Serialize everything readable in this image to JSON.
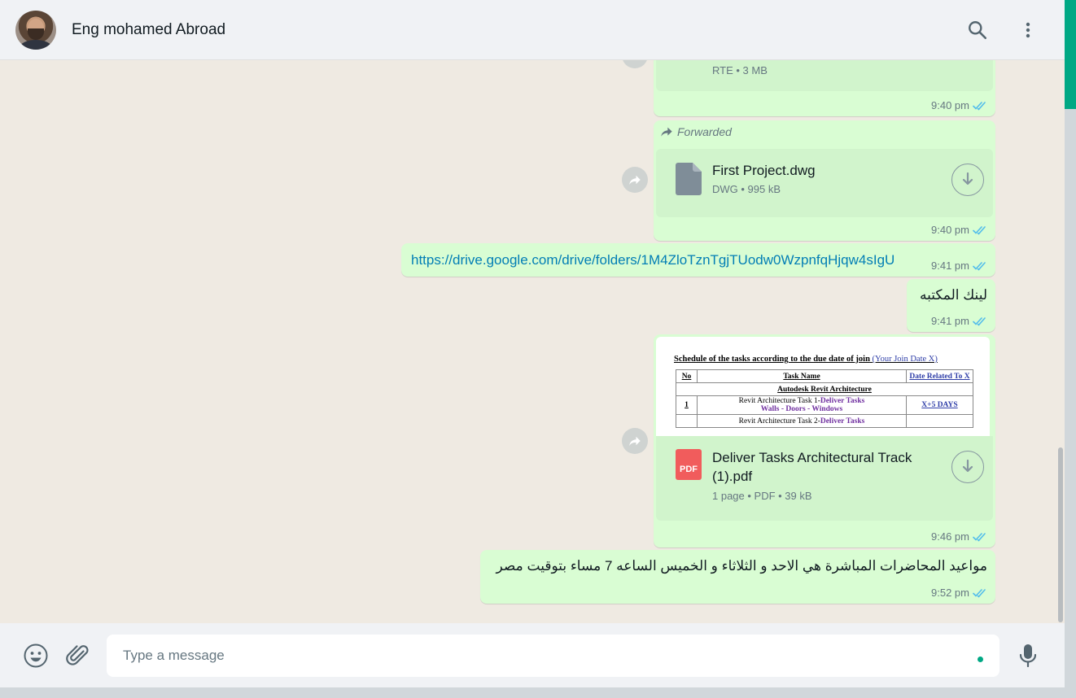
{
  "header": {
    "contact_name": "Eng mohamed Abroad",
    "icons": [
      "search-icon",
      "menu-dots-icon"
    ]
  },
  "messages": {
    "doc_top": {
      "sub": "RTE • 3 MB",
      "time": "9:40 pm"
    },
    "doc_dwg": {
      "forwarded_label": "Forwarded",
      "name": "First Project.dwg",
      "sub": "DWG • 995 kB",
      "time": "9:40 pm"
    },
    "link_msg": {
      "text": "https://drive.google.com/drive/folders/1M4ZloTznTgjTUodw0WzpnfqHjqw4sIgU",
      "time": "9:41 pm"
    },
    "text_library": {
      "text": "لينك المكتبه",
      "time": "9:41 pm"
    },
    "doc_pdf": {
      "preview": {
        "title": "Schedule of the tasks according to the due date of join",
        "title_link": "(Your Join Date   X)",
        "col_no": "No",
        "col_task": "Task Name",
        "col_date": "Date Related To X",
        "section": "Autodesk Revit Architecture",
        "row1_no": "1",
        "row1_task": "Revit Architecture Task 1-",
        "row1_task_hl": "Deliver Tasks",
        "row1_task_sub": "Walls - Doors - Windows",
        "row1_date": "X+5 DAYS",
        "row2_task": "Revit Architecture Task 2-",
        "row2_task_hl": "Deliver Tasks"
      },
      "icon_label": "PDF",
      "name_line1": "Deliver Tasks Architectural Track",
      "name_line2": "(1).pdf",
      "sub": "1 page • PDF • 39 kB",
      "time": "9:46 pm"
    },
    "text_schedule": {
      "text": "مواعيد المحاضرات المباشرة هي الاحد و الثلاثاء و الخميس الساعه 7 مساء بتوقيت مصر",
      "time": "9:52 pm"
    }
  },
  "footer": {
    "placeholder": "Type a message",
    "icons": [
      "emoji-icon",
      "attach-icon",
      "mic-icon"
    ]
  },
  "colors": {
    "outgoing_bubble": "#d9fdd3",
    "doc_card": "#d1f4cc",
    "chat_background": "#efeae2",
    "accent": "#00a884",
    "read_ticks": "#53bdeb",
    "link": "#027eb5"
  }
}
